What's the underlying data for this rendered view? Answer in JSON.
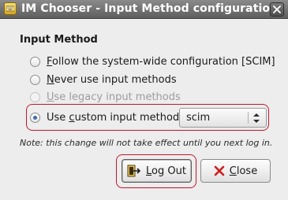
{
  "window": {
    "title": "IM Chooser - Input Method configuration"
  },
  "section": {
    "title": "Input Method"
  },
  "options": [
    {
      "pre": "",
      "underline": "F",
      "post": "ollow the system-wide configuration [SCIM]",
      "checked": false,
      "disabled": false
    },
    {
      "pre": "",
      "underline": "N",
      "post": "ever use input methods",
      "checked": false,
      "disabled": false
    },
    {
      "pre": "",
      "underline": "U",
      "post": "se legacy input methods",
      "checked": false,
      "disabled": true
    },
    {
      "pre": "Use ",
      "underline": "c",
      "post": "ustom input method",
      "checked": true,
      "disabled": false
    }
  ],
  "combo": {
    "selected": "scim"
  },
  "note": "Note: this change will not take effect until you next log in.",
  "buttons": {
    "logout": {
      "underline": "L",
      "post": "og Out"
    },
    "close": {
      "underline": "C",
      "post": "lose"
    }
  },
  "icons": {
    "app": "keyboard-icon",
    "close": "close-icon",
    "logout": "logout-icon",
    "close_button": "close-x-icon",
    "combo": "updown-arrows-icon"
  },
  "colors": {
    "highlight": "#c0162a",
    "radio_selected": "#3a6ea8",
    "close_x": "#d21a1a"
  }
}
